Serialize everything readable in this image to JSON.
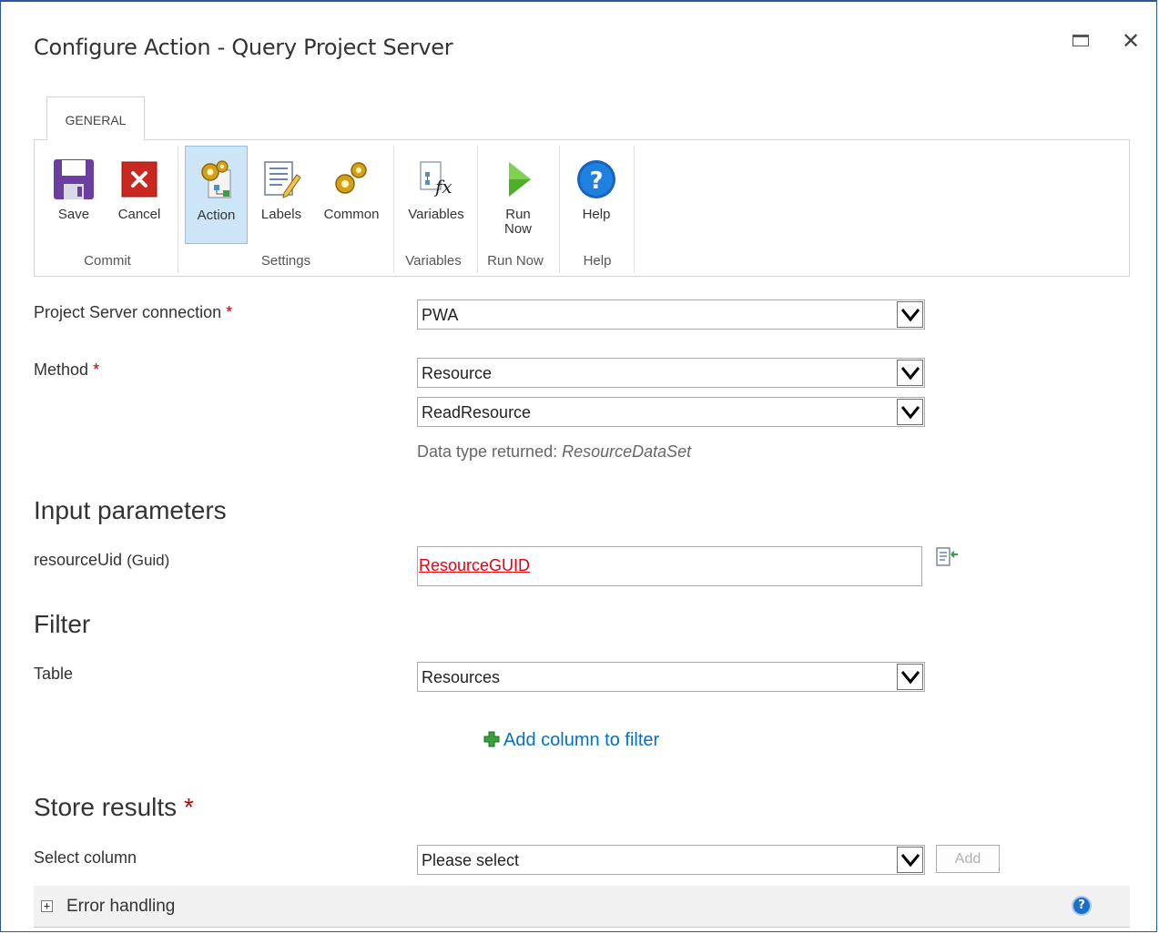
{
  "dialog": {
    "title": "Configure Action - Query Project Server"
  },
  "ribbon": {
    "tab": "GENERAL",
    "buttons": {
      "save": "Save",
      "cancel": "Cancel",
      "action": "Action",
      "labels": "Labels",
      "common": "Common",
      "variables": "Variables",
      "run_now_line1": "Run",
      "run_now_line2": "Now",
      "help": "Help"
    },
    "groups": {
      "commit": "Commit",
      "settings": "Settings",
      "variables": "Variables",
      "run_now": "Run Now",
      "help": "Help"
    },
    "icons": [
      "floppy-disk-icon",
      "cancel-x-icon",
      "gears-action-icon",
      "labels-list-icon",
      "gears-common-icon",
      "fx-variables-icon",
      "play-icon",
      "help-icon"
    ]
  },
  "form": {
    "connection_label": "Project Server connection",
    "connection_value": "PWA",
    "method_label": "Method",
    "method_value": "Resource",
    "method_op_value": "ReadResource",
    "data_type_prefix": "Data type returned:",
    "data_type_value": "ResourceDataSet",
    "required_mark": "*"
  },
  "input_parameters": {
    "heading": "Input parameters",
    "param_name": "resourceUid",
    "param_type": "(Guid)",
    "param_value": "ResourceGUID"
  },
  "filter": {
    "heading": "Filter",
    "table_label": "Table",
    "table_value": "Resources",
    "add_column_link": "Add column to filter"
  },
  "store_results": {
    "heading": "Store results",
    "select_column_label": "Select column",
    "select_column_value": "Please select",
    "add_button": "Add"
  },
  "error_handling": {
    "expand_symbol": "+",
    "label": "Error handling"
  },
  "colors": {
    "accent": "#0072c6",
    "required": "#bf0000",
    "token": "#e8000b",
    "selected_button": "#cde6f7"
  }
}
